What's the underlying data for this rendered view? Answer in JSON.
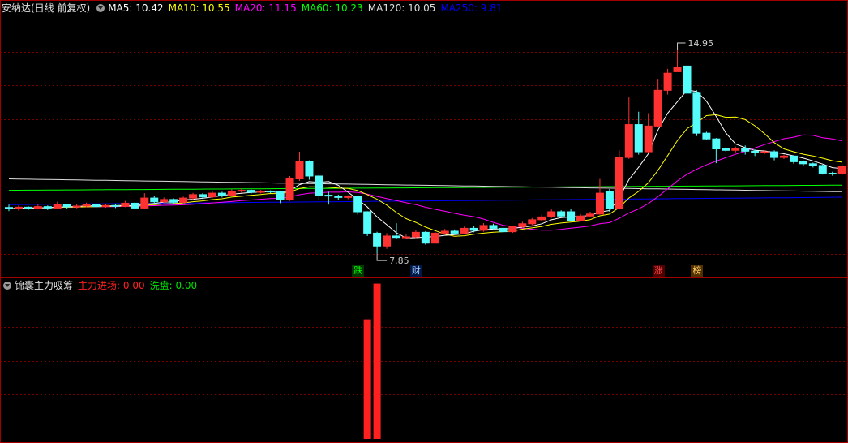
{
  "title": "安纳达(日线 前复权)",
  "ma_legend": [
    {
      "label": "MA5: 10.42",
      "color": "#ffffff"
    },
    {
      "label": "MA10: 10.55",
      "color": "#ffff00"
    },
    {
      "label": "MA20: 11.15",
      "color": "#ff00ff"
    },
    {
      "label": "MA60: 10.23",
      "color": "#00ff00"
    },
    {
      "label": "MA120: 10.05",
      "color": "#dddddd"
    },
    {
      "label": "MA250: 9.81",
      "color": "#0000ff"
    }
  ],
  "indicator": {
    "name": "锦囊主力吸筹",
    "main_label": "主力进场: 0.00",
    "main_color": "#ff2020",
    "wash_label": "洗盘: 0.00",
    "wash_color": "#00e000"
  },
  "colors": {
    "up": "#ff3232",
    "down": "#54fcfc",
    "grid": "#7a0000",
    "frame": "#a00000"
  },
  "event_tags": [
    {
      "label": "跌",
      "bg": "#003800",
      "fg": "#00ff00",
      "index": 36
    },
    {
      "label": "财",
      "bg": "#001848",
      "fg": "#aaccff",
      "index": 42
    },
    {
      "label": "涨",
      "bg": "#500000",
      "fg": "#ff4444",
      "index": 67
    },
    {
      "label": "榜",
      "bg": "#503000",
      "fg": "#ffcc66",
      "index": 71
    }
  ],
  "chart_data": {
    "type": "candlestick",
    "price_range": [
      7.0,
      16.2
    ],
    "high_label": "14.95",
    "low_label": "7.85",
    "candles": [
      [
        9.45,
        9.4,
        9.55,
        9.32
      ],
      [
        9.4,
        9.46,
        9.52,
        9.34
      ],
      [
        9.46,
        9.42,
        9.5,
        9.36
      ],
      [
        9.42,
        9.48,
        9.55,
        9.38
      ],
      [
        9.48,
        9.43,
        9.52,
        9.36
      ],
      [
        9.43,
        9.55,
        9.65,
        9.4
      ],
      [
        9.55,
        9.47,
        9.58,
        9.4
      ],
      [
        9.47,
        9.5,
        9.56,
        9.42
      ],
      [
        9.5,
        9.56,
        9.62,
        9.45
      ],
      [
        9.56,
        9.48,
        9.6,
        9.42
      ],
      [
        9.48,
        9.52,
        9.58,
        9.44
      ],
      [
        9.52,
        9.49,
        9.57,
        9.43
      ],
      [
        9.49,
        9.6,
        9.68,
        9.46
      ],
      [
        9.6,
        9.43,
        9.63,
        9.38
      ],
      [
        9.43,
        9.78,
        9.95,
        9.4
      ],
      [
        9.78,
        9.65,
        9.84,
        9.58
      ],
      [
        9.65,
        9.73,
        9.8,
        9.6
      ],
      [
        9.73,
        9.63,
        9.77,
        9.58
      ],
      [
        9.63,
        9.78,
        9.83,
        9.6
      ],
      [
        9.78,
        9.9,
        9.96,
        9.72
      ],
      [
        9.9,
        9.82,
        9.95,
        9.75
      ],
      [
        9.82,
        9.95,
        10.02,
        9.78
      ],
      [
        9.95,
        9.88,
        10.0,
        9.8
      ],
      [
        9.88,
        10.02,
        10.08,
        9.84
      ],
      [
        10.02,
        10.05,
        10.12,
        9.96
      ],
      [
        10.05,
        9.98,
        10.08,
        9.92
      ],
      [
        9.98,
        10.02,
        10.06,
        9.94
      ],
      [
        10.02,
        10.0,
        10.05,
        9.95
      ],
      [
        10.0,
        9.72,
        10.04,
        9.6
      ],
      [
        9.72,
        10.45,
        10.55,
        9.68
      ],
      [
        10.45,
        11.05,
        11.4,
        10.38
      ],
      [
        11.05,
        10.55,
        11.1,
        10.42
      ],
      [
        10.55,
        9.88,
        10.6,
        9.72
      ],
      [
        9.88,
        9.85,
        10.0,
        9.55
      ],
      [
        9.85,
        9.8,
        9.9,
        9.7
      ],
      [
        9.8,
        9.84,
        9.88,
        9.74
      ],
      [
        9.84,
        9.3,
        9.86,
        9.2
      ],
      [
        9.3,
        8.55,
        9.32,
        8.45
      ],
      [
        8.55,
        8.1,
        8.6,
        7.85
      ],
      [
        8.1,
        8.45,
        8.55,
        8.0
      ],
      [
        8.45,
        8.4,
        8.9,
        8.35
      ],
      [
        8.4,
        8.42,
        8.5,
        8.36
      ],
      [
        8.42,
        8.58,
        8.65,
        8.38
      ],
      [
        8.58,
        8.2,
        8.62,
        8.15
      ],
      [
        8.2,
        8.55,
        8.6,
        8.18
      ],
      [
        8.55,
        8.62,
        8.7,
        8.5
      ],
      [
        8.62,
        8.55,
        8.68,
        8.5
      ],
      [
        8.55,
        8.72,
        8.78,
        8.52
      ],
      [
        8.72,
        8.65,
        8.8,
        8.58
      ],
      [
        8.65,
        8.82,
        8.9,
        8.6
      ],
      [
        8.82,
        8.72,
        8.88,
        8.68
      ],
      [
        8.72,
        8.6,
        8.78,
        8.55
      ],
      [
        8.6,
        8.78,
        8.82,
        8.56
      ],
      [
        8.78,
        8.88,
        8.95,
        8.74
      ],
      [
        8.88,
        9.02,
        9.08,
        8.82
      ],
      [
        9.02,
        9.12,
        9.2,
        8.98
      ],
      [
        9.12,
        9.3,
        9.38,
        9.08
      ],
      [
        9.3,
        9.15,
        9.35,
        9.1
      ],
      [
        9.3,
        9.0,
        9.4,
        8.95
      ],
      [
        9.0,
        9.15,
        9.22,
        8.96
      ],
      [
        9.15,
        9.22,
        9.3,
        9.1
      ],
      [
        9.22,
        9.95,
        10.45,
        9.2
      ],
      [
        10.0,
        9.4,
        10.1,
        9.3
      ],
      [
        9.4,
        11.2,
        11.45,
        9.38
      ],
      [
        11.2,
        12.35,
        13.3,
        11.15
      ],
      [
        12.35,
        11.4,
        12.8,
        11.3
      ],
      [
        11.4,
        12.3,
        12.75,
        11.35
      ],
      [
        12.3,
        13.55,
        13.95,
        12.25
      ],
      [
        13.55,
        14.15,
        14.3,
        13.4
      ],
      [
        14.2,
        14.35,
        14.95,
        14.2
      ],
      [
        14.4,
        13.45,
        14.7,
        13.3
      ],
      [
        13.45,
        12.05,
        13.55,
        11.95
      ],
      [
        12.05,
        11.85,
        12.1,
        11.8
      ],
      [
        11.85,
        11.5,
        11.88,
        11.0
      ],
      [
        11.5,
        11.45,
        11.55,
        11.4
      ],
      [
        11.45,
        11.5,
        11.58,
        11.38
      ],
      [
        11.5,
        11.42,
        11.62,
        11.3
      ],
      [
        11.42,
        11.38,
        11.48,
        11.25
      ],
      [
        11.38,
        11.4,
        11.46,
        11.32
      ],
      [
        11.4,
        11.2,
        11.45,
        11.1
      ],
      [
        11.2,
        11.25,
        11.3,
        11.15
      ],
      [
        11.25,
        11.05,
        11.28,
        10.98
      ],
      [
        11.05,
        10.98,
        11.1,
        10.9
      ],
      [
        10.98,
        10.92,
        11.02,
        10.85
      ],
      [
        10.92,
        10.65,
        10.95,
        10.6
      ],
      [
        10.65,
        10.62,
        10.7,
        10.56
      ],
      [
        10.62,
        10.9,
        10.96,
        10.58
      ]
    ],
    "indicator_bars": [
      {
        "index": 37,
        "value": 0.77
      },
      {
        "index": 38,
        "value": 1.0
      }
    ],
    "indicator_range": [
      0,
      1.05
    ]
  }
}
